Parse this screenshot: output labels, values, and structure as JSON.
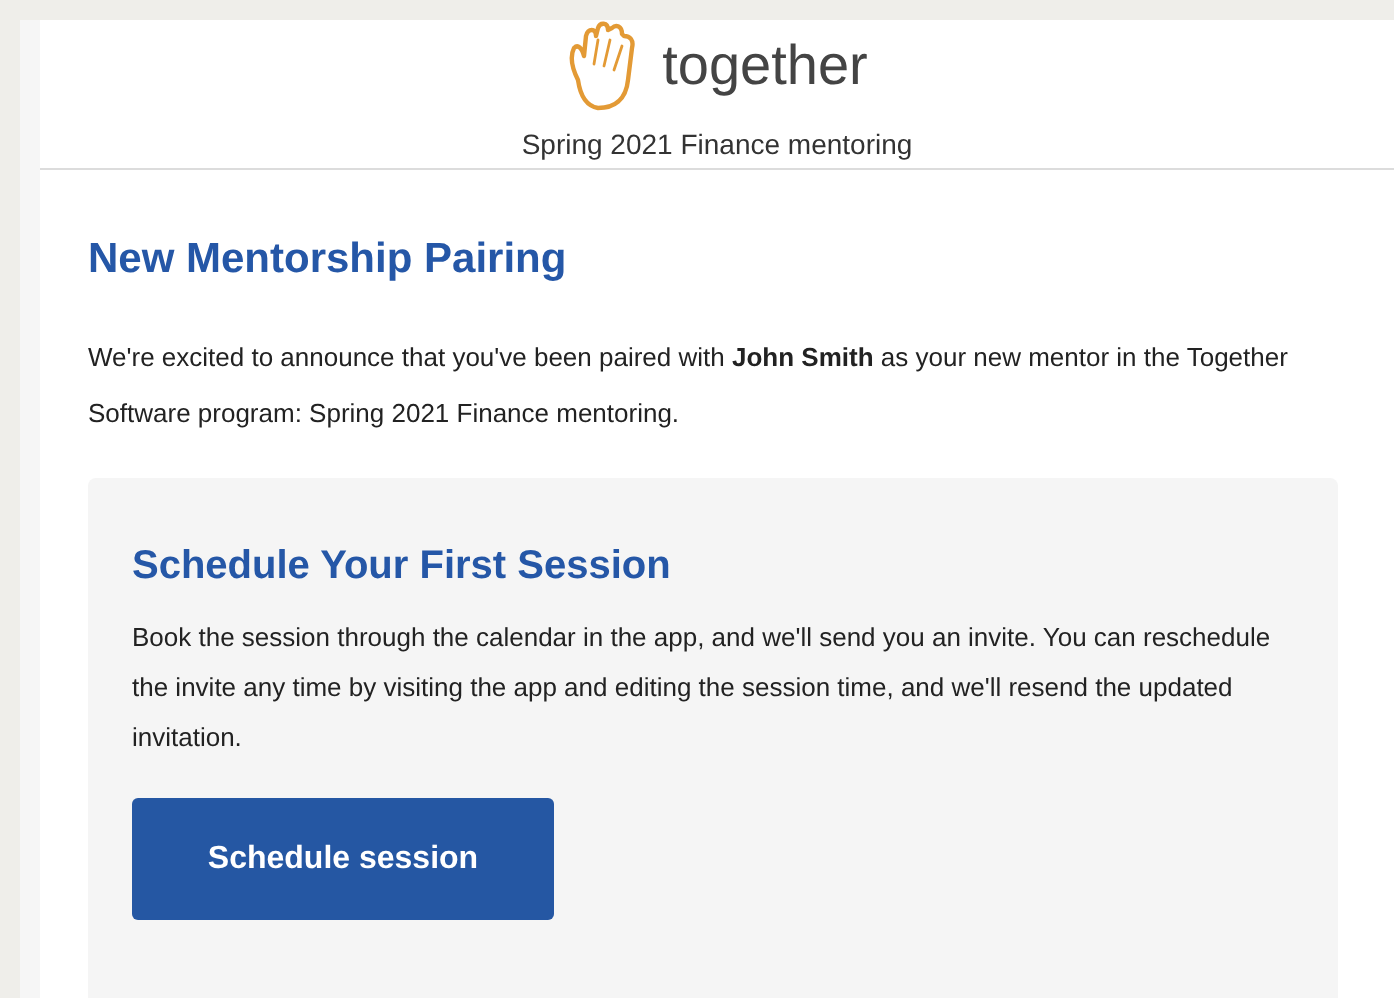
{
  "header": {
    "logo_text": "together",
    "subtitle": "Spring 2021 Finance mentoring"
  },
  "title": "New Mentorship Pairing",
  "intro": "We're excited to announce that you've been paired with **John Smith** as your new mentor in the Together Software program: Spring 2021 Finance mentoring.",
  "card": {
    "title": "Schedule Your First Session",
    "body": "Book the session through the calendar in the app, and we'll send you an invite. You can reschedule the invite any time by visiting the app and editing the session time, and we'll resend the updated invitation.",
    "button": "Schedule session"
  }
}
